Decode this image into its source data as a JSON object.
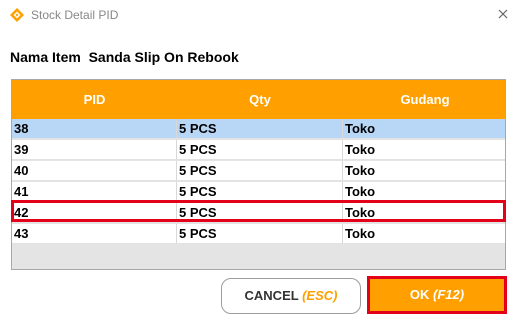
{
  "window": {
    "title": "Stock Detail PID"
  },
  "item": {
    "label": "Nama Item",
    "name": "Sanda Slip On Rebook"
  },
  "table": {
    "columns": [
      "PID",
      "Qty",
      "Gudang"
    ],
    "rows": [
      {
        "pid": "38",
        "qty": "5 PCS",
        "gudang": "Toko"
      },
      {
        "pid": "39",
        "qty": "5 PCS",
        "gudang": "Toko"
      },
      {
        "pid": "40",
        "qty": "5 PCS",
        "gudang": "Toko"
      },
      {
        "pid": "41",
        "qty": "5 PCS",
        "gudang": "Toko"
      },
      {
        "pid": "42",
        "qty": "5 PCS",
        "gudang": "Toko"
      },
      {
        "pid": "43",
        "qty": "5 PCS",
        "gudang": "Toko"
      }
    ],
    "selected_row_pid": "38",
    "highlighted_row_pid": "42"
  },
  "buttons": {
    "cancel": {
      "label": "CANCEL",
      "shortcut": "(ESC)"
    },
    "ok": {
      "label": "OK",
      "shortcut": "(F12)"
    }
  },
  "colors": {
    "accent": "#ffa000",
    "highlight_border": "#e3001b",
    "selected_row": "#b8d7f7",
    "grid_empty": "#e4e4e4"
  },
  "icons": {
    "app": "app-logo-icon",
    "close": "close-icon"
  }
}
